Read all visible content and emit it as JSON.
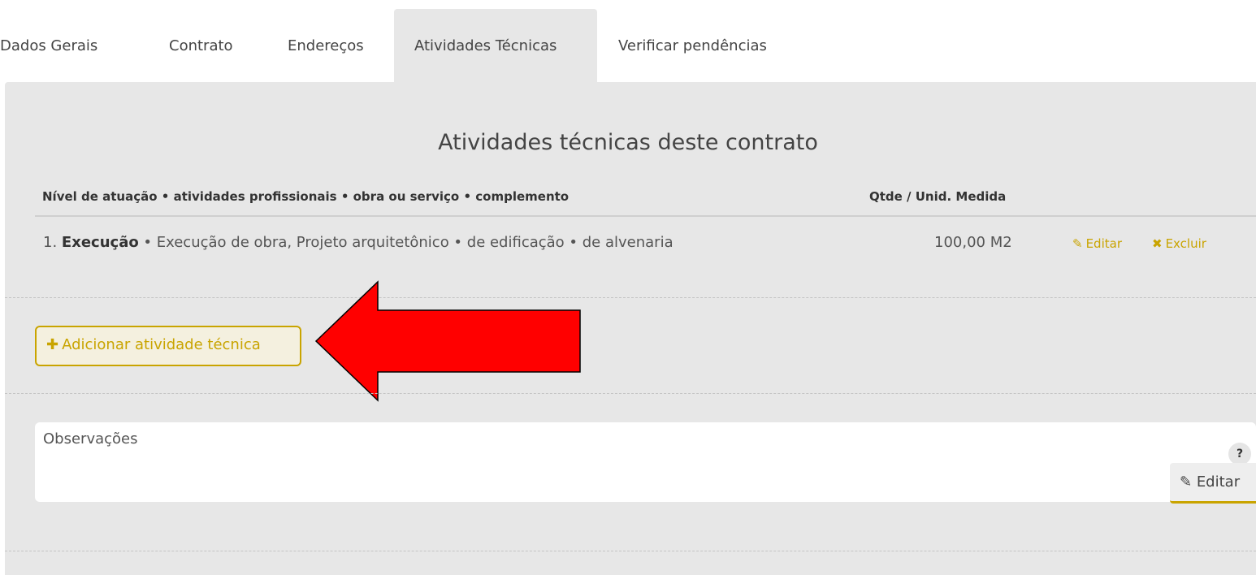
{
  "tabs": [
    "Dados Gerais",
    "Contrato",
    "Endereços",
    "Atividades Técnicas",
    "Verificar pendências"
  ],
  "active_tab": "Atividades Técnicas",
  "section_title": "Atividades técnicas deste contrato",
  "columns": {
    "description": "Nível de atuação • atividades profissionais • obra ou serviço • complemento",
    "quantity": "Qtde / Unid. Medida"
  },
  "rows": [
    {
      "index": "1.",
      "level": "Execução",
      "details": " • Execução de obra, Projeto arquitetônico • de edificação • de alvenaria",
      "quantity": "100,00 M2",
      "edit_label": "Editar",
      "delete_label": "Excluir"
    }
  ],
  "add_button_label": "Adicionar atividade técnica",
  "observations": {
    "label": "Observações",
    "help": "?",
    "edit_label": "Editar"
  },
  "colors": {
    "accent": "#c9a400",
    "panel": "#e7e7e7",
    "arrow": "#ff0000"
  }
}
